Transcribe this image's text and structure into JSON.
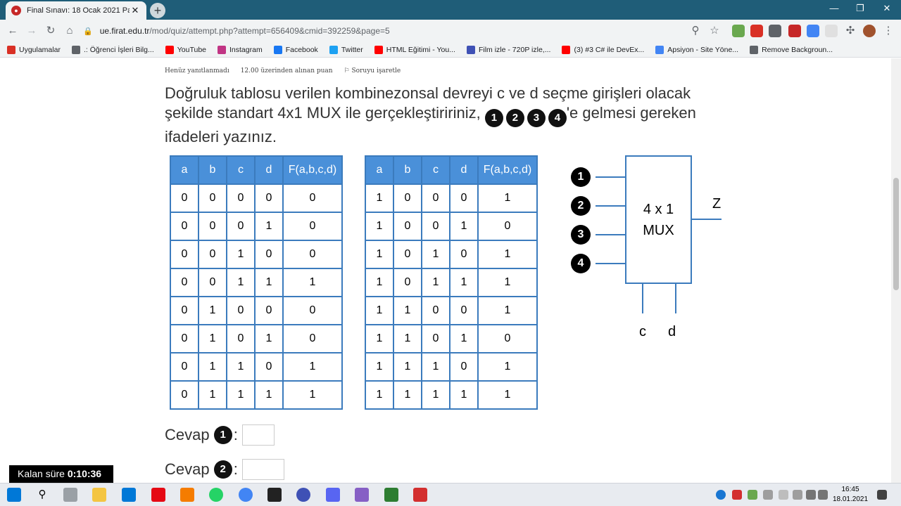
{
  "browser": {
    "tab_title": "Final Sınavı: 18 Ocak 2021 Pazart",
    "url_host": "ue.firat.edu.tr",
    "url_rest": "/mod/quiz/attempt.php?attempt=656409&cmid=392259&page=5"
  },
  "bookmarks": [
    {
      "label": "Uygulamalar",
      "color": "#d93025"
    },
    {
      "label": ".: Öğrenci İşleri Bilg...",
      "color": "#5f6368"
    },
    {
      "label": "YouTube",
      "color": "#ff0000"
    },
    {
      "label": "Instagram",
      "color": "#c13584"
    },
    {
      "label": "Facebook",
      "color": "#1877f2"
    },
    {
      "label": "Twitter",
      "color": "#1da1f2"
    },
    {
      "label": "HTML Eğitimi - You...",
      "color": "#ff0000"
    },
    {
      "label": "Film izle - 720P izle,...",
      "color": "#3f51b5"
    },
    {
      "label": "(3) #3 C# ile DevEx...",
      "color": "#ff0000"
    },
    {
      "label": "Apsiyon - Site Yöne...",
      "color": "#4285f4"
    },
    {
      "label": "Remove Backgroun...",
      "color": "#5f6368"
    }
  ],
  "question": {
    "status": "Henüz yanıtlanmadı",
    "points": "12.00 üzerinden alınan puan",
    "flag": "Soruyu işaretle",
    "text_1": "Doğruluk tablosu verilen kombinezonsal devreyi c ve d seçme girişleri olacak şekilde standart 4x1 MUX ile gerçekleştiririniz,",
    "markers": [
      "1",
      "2",
      "3",
      "4"
    ],
    "text_2": "'e gelmesi gereken ifadeleri yazınız."
  },
  "truth_table": {
    "headers": [
      "a",
      "b",
      "c",
      "d",
      "F(a,b,c,d)"
    ],
    "left_rows": [
      [
        "0",
        "0",
        "0",
        "0",
        "0"
      ],
      [
        "0",
        "0",
        "0",
        "1",
        "0"
      ],
      [
        "0",
        "0",
        "1",
        "0",
        "0"
      ],
      [
        "0",
        "0",
        "1",
        "1",
        "1"
      ],
      [
        "0",
        "1",
        "0",
        "0",
        "0"
      ],
      [
        "0",
        "1",
        "0",
        "1",
        "0"
      ],
      [
        "0",
        "1",
        "1",
        "0",
        "1"
      ],
      [
        "0",
        "1",
        "1",
        "1",
        "1"
      ]
    ],
    "right_rows": [
      [
        "1",
        "0",
        "0",
        "0",
        "1"
      ],
      [
        "1",
        "0",
        "0",
        "1",
        "0"
      ],
      [
        "1",
        "0",
        "1",
        "0",
        "1"
      ],
      [
        "1",
        "0",
        "1",
        "1",
        "1"
      ],
      [
        "1",
        "1",
        "0",
        "0",
        "1"
      ],
      [
        "1",
        "1",
        "0",
        "1",
        "0"
      ],
      [
        "1",
        "1",
        "1",
        "0",
        "1"
      ],
      [
        "1",
        "1",
        "1",
        "1",
        "1"
      ]
    ]
  },
  "mux": {
    "line1": "4 x 1",
    "line2": "MUX",
    "output": "Z",
    "inputs": [
      "1",
      "2",
      "3",
      "4"
    ],
    "select_c": "c",
    "select_d": "d"
  },
  "answers": [
    {
      "label": "Cevap",
      "marker": "1"
    },
    {
      "label": "Cevap",
      "marker": "2"
    }
  ],
  "timer": {
    "label": "Kalan süre",
    "value": "0:10:36"
  },
  "clock": {
    "time": "16:45",
    "date": "18.01.2021"
  }
}
